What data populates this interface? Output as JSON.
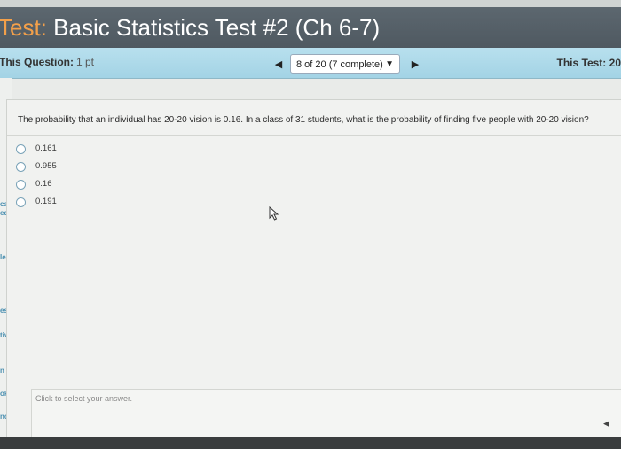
{
  "window": {
    "title_prefix": "Test:",
    "title_rest": " Basic Statistics Test #2 (Ch 6-7)"
  },
  "question_bar": {
    "label": "This Question:",
    "points": "1 pt",
    "progress_text": "8 of 20 (7 complete)",
    "this_test_label": "This Test:",
    "this_test_value": "20"
  },
  "sidebar": {
    "items": [
      "cal",
      "ed",
      "les",
      "ests",
      "tivity",
      "n",
      "ok",
      "nch"
    ]
  },
  "question": {
    "text": "The probability that an individual has 20-20 vision is 0.16. In a class of 31 students, what is the probability of finding five people with 20-20 vision?",
    "options": [
      "0.161",
      "0.955",
      "0.16",
      "0.191"
    ],
    "answer_hint": "Click to select your answer."
  },
  "icons": {
    "prev": "triangle-left-icon",
    "next": "triangle-right-icon",
    "dropdown": "triangle-down-icon",
    "cursor": "mouse-pointer-icon"
  },
  "colors": {
    "title_bar": "#566068",
    "title_prefix": "#f3a04a",
    "question_bar": "#acd8e8",
    "sidebar_link": "#4a8fb0"
  }
}
